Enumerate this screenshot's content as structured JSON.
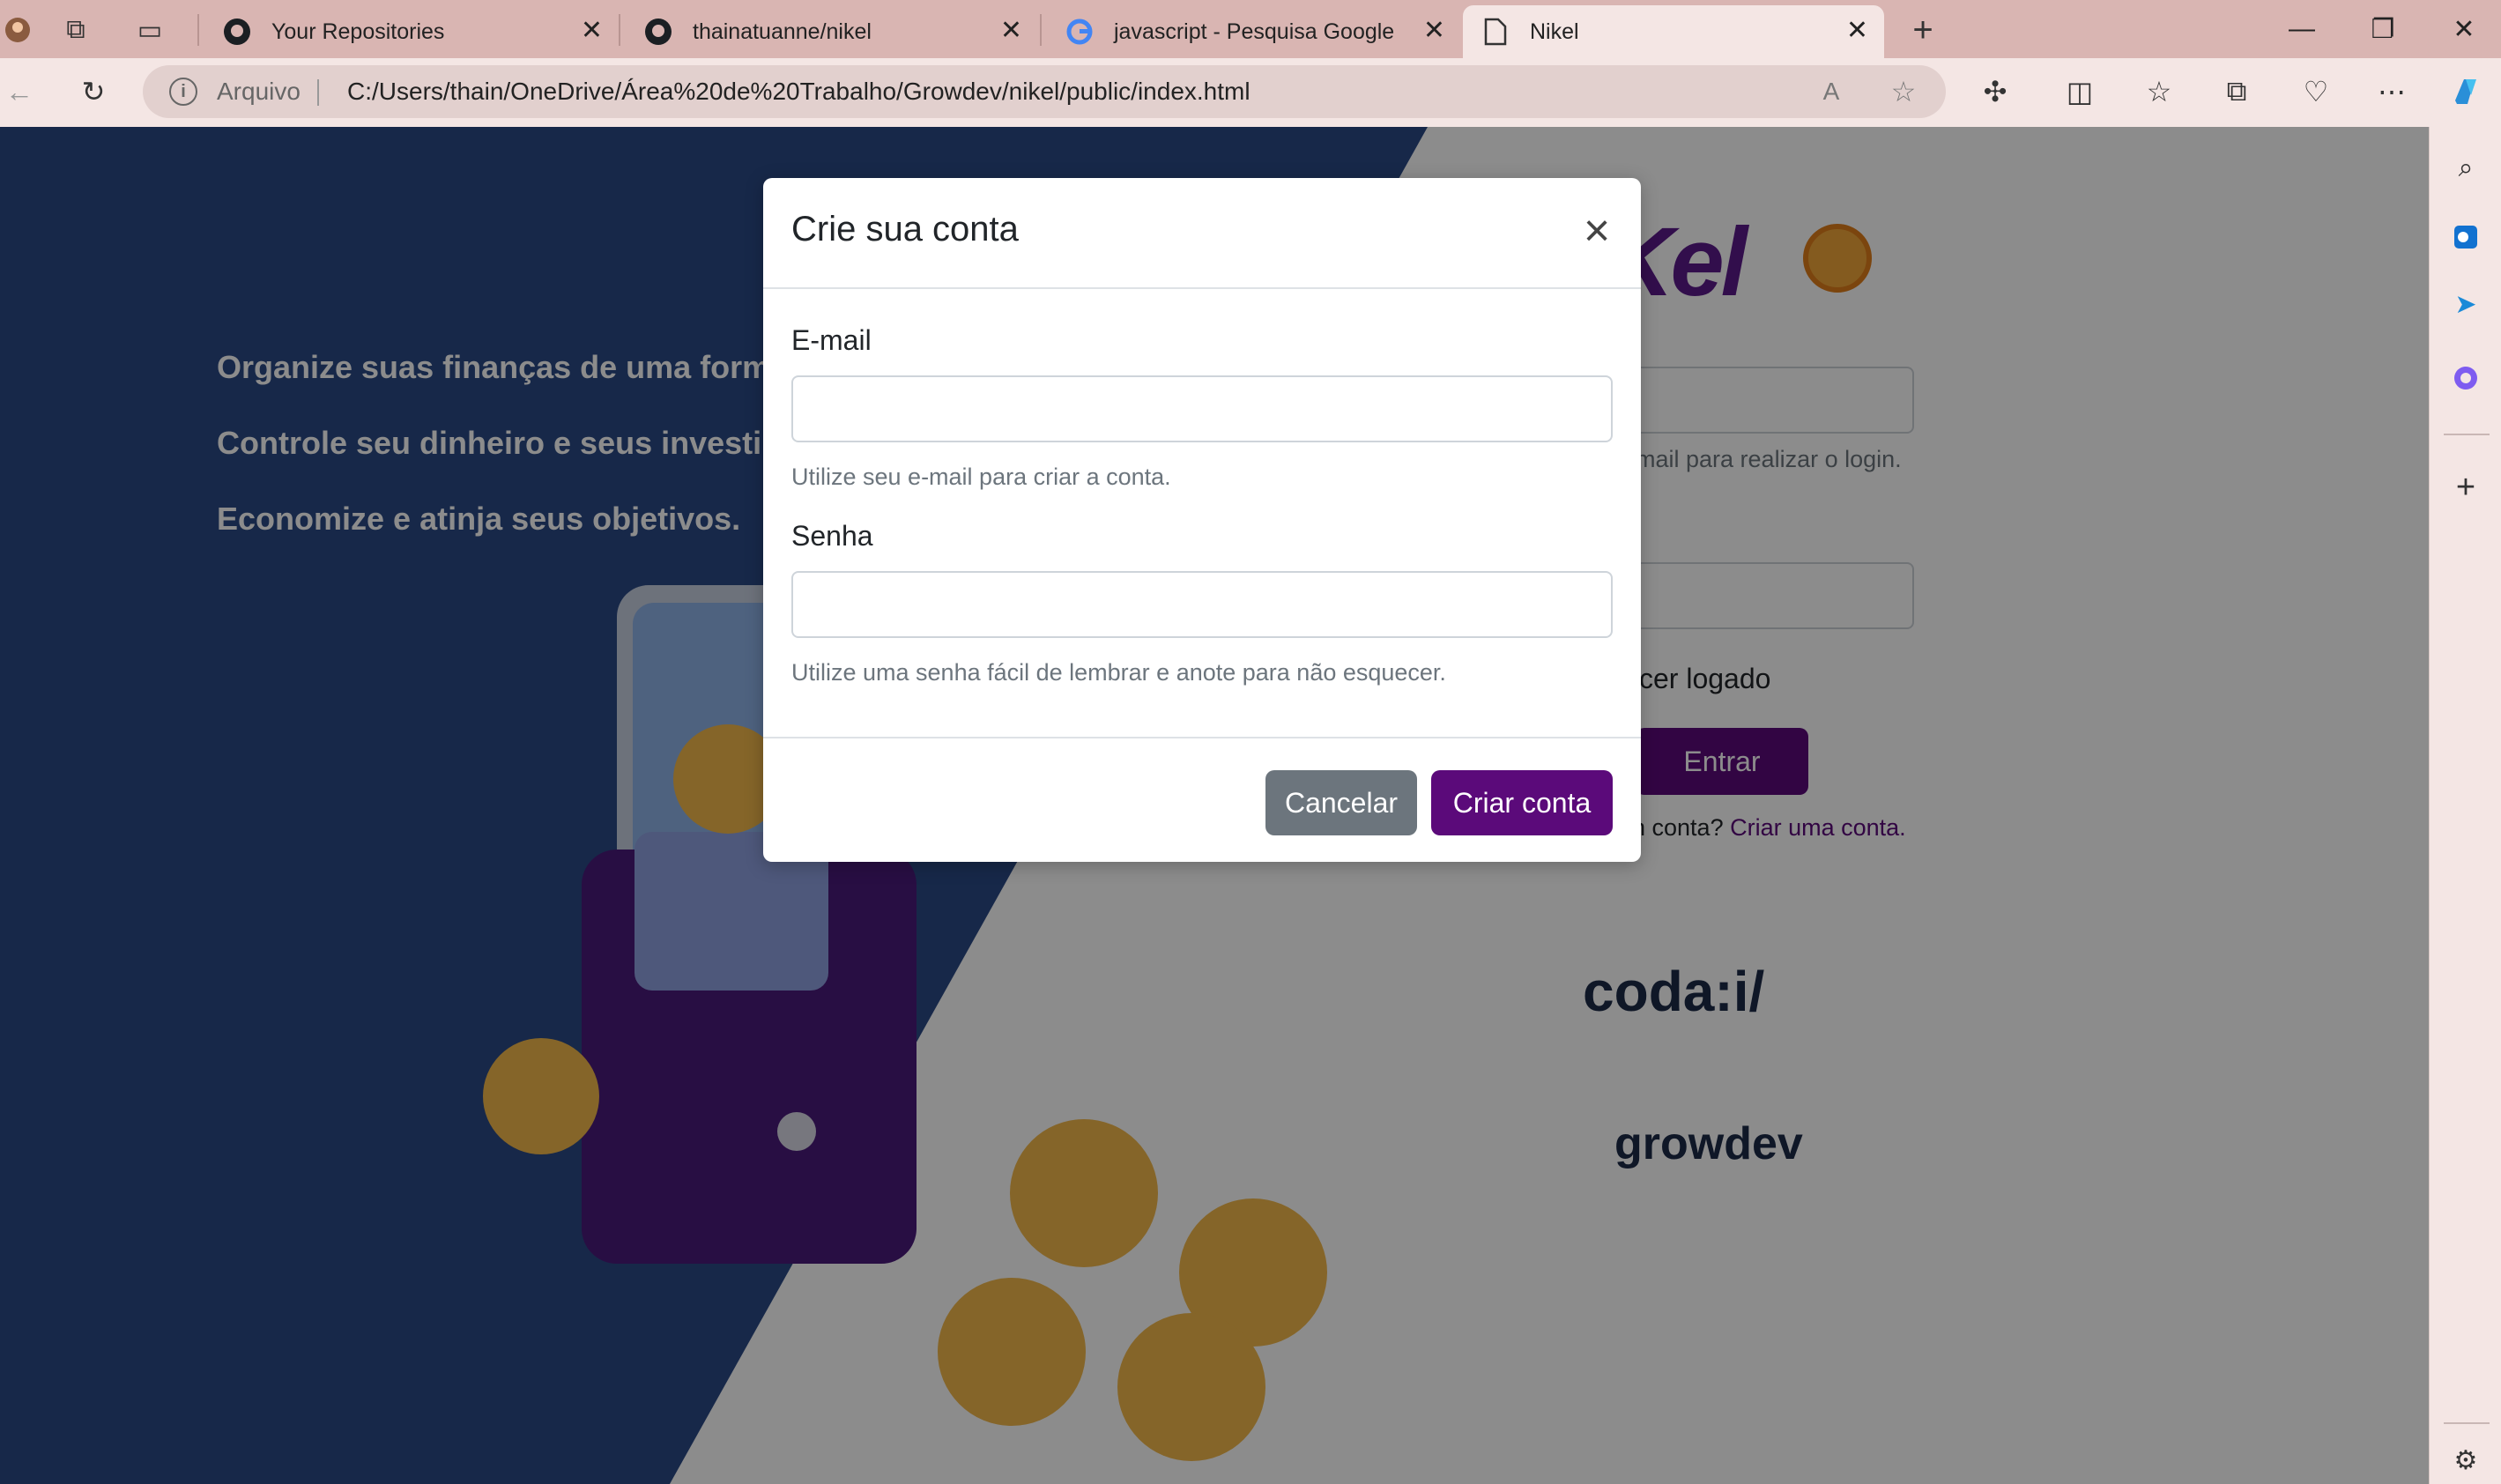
{
  "browser": {
    "tabs": [
      {
        "title": "Your Repositories",
        "favicon": "github-icon"
      },
      {
        "title": "thainatuanne/nikel",
        "favicon": "github-icon"
      },
      {
        "title": "javascript - Pesquisa Google",
        "favicon": "google-icon"
      },
      {
        "title": "Nikel",
        "favicon": "page-icon",
        "active": true
      }
    ],
    "address": {
      "label": "Arquivo",
      "url": "C:/Users/thain/OneDrive/Área%20de%20Trabalho/Growdev/nikel/public/index.html"
    }
  },
  "page": {
    "taglines": [
      "Organize suas finanças de uma forma",
      "Controle seu dinheiro e seus investime",
      "Economize e atinja seus objetivos."
    ],
    "logo_text": "Kel",
    "email_helper_partial": "mail para realizar o login.",
    "keep_logged_partial": "cer logado",
    "enter_button": "Entrar",
    "create_account_prefix": "n conta?",
    "create_account_link": "Criar uma conta.",
    "partner_logos": [
      "coda:i/",
      "growdev"
    ]
  },
  "modal": {
    "title": "Crie sua conta",
    "email_label": "E-mail",
    "email_value": "",
    "email_help": "Utilize seu e-mail para criar a conta.",
    "password_label": "Senha",
    "password_value": "",
    "password_help": "Utilize uma senha fácil de lembrar e anote para não esquecer.",
    "cancel_label": "Cancelar",
    "submit_label": "Criar conta"
  },
  "colors": {
    "brand_purple": "#5b0a7a",
    "secondary_gray": "#6c757d",
    "hero_blue": "#2b4a86",
    "chrome_pink": "#d9b5b2"
  }
}
